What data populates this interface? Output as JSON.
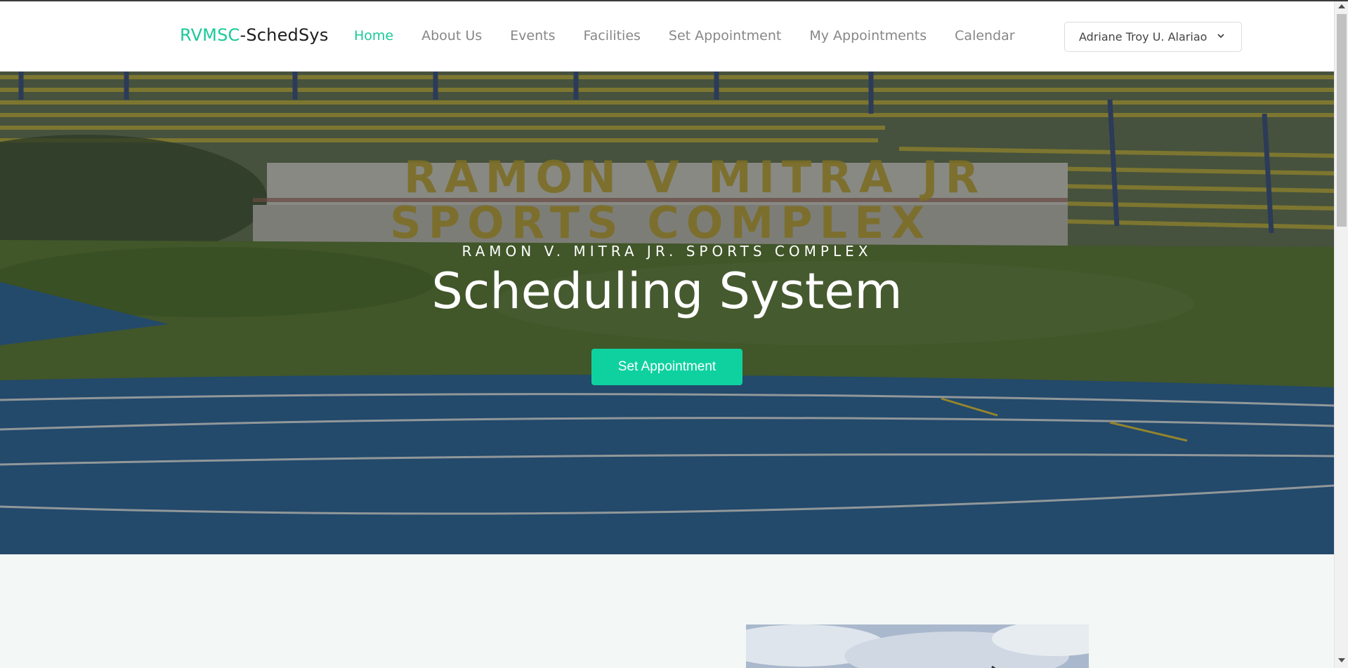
{
  "navbar": {
    "brand_accent": "RVMSC",
    "brand_rest": "-SchedSys",
    "links": [
      {
        "label": "Home",
        "active": true
      },
      {
        "label": "About Us"
      },
      {
        "label": "Events"
      },
      {
        "label": "Facilities"
      },
      {
        "label": "Set Appointment"
      },
      {
        "label": "My Appointments"
      },
      {
        "label": "Calendar"
      }
    ],
    "user_name": "Adriane Troy U. Alariao"
  },
  "hero": {
    "subtitle": "RAMON V. MITRA JR. SPORTS COMPLEX",
    "title": "Scheduling System",
    "button_label": "Set Appointment"
  },
  "colors": {
    "accent": "#1bc99a",
    "button": "#0fd1a0"
  }
}
